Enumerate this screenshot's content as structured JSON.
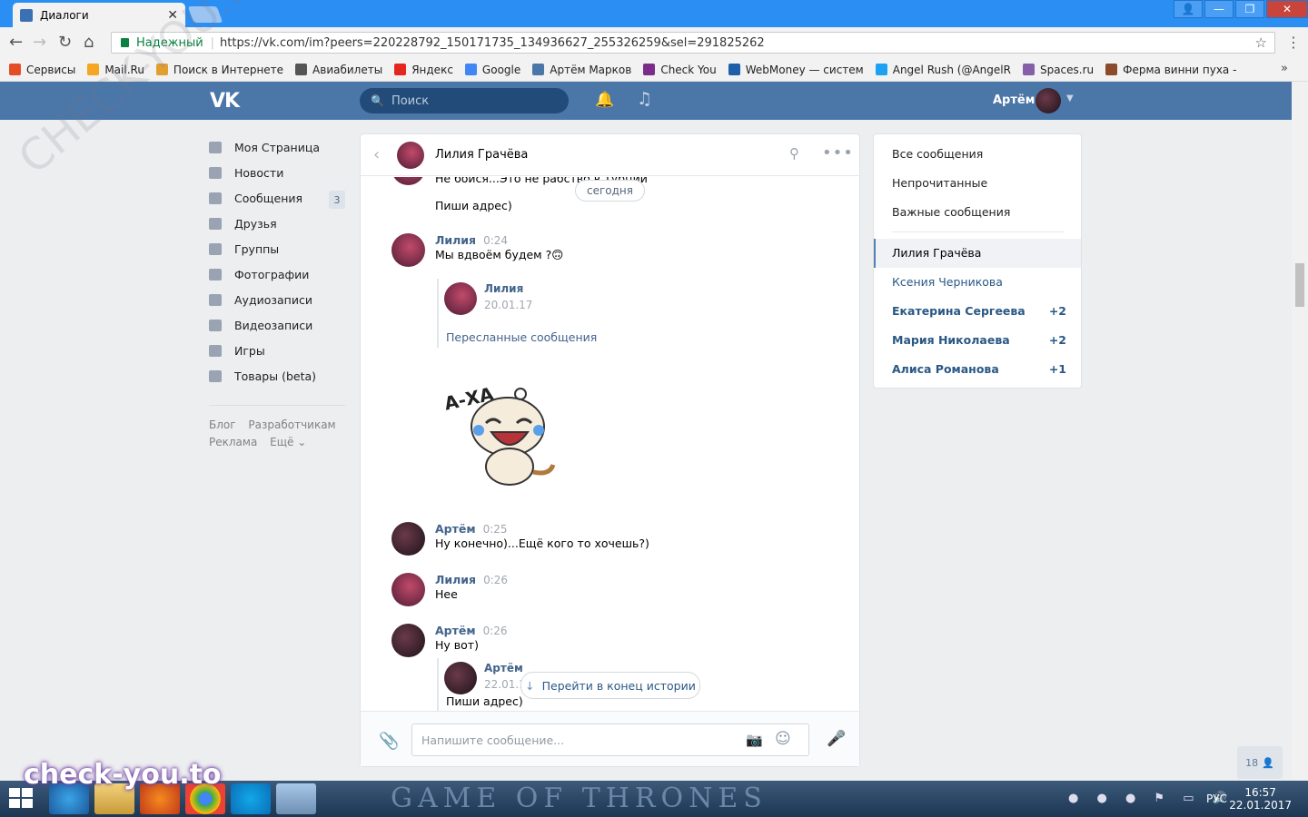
{
  "browser": {
    "tab_title": "Диалоги",
    "secure_label": "Надежный",
    "url": "https://vk.com/im?peers=220228792_150171735_134936627_255326259&sel=291825262"
  },
  "bookmarks": [
    {
      "label": "Сервисы",
      "icon": "apps-grid-icon",
      "color": "#e44d26"
    },
    {
      "label": "Mail.Ru",
      "icon": "mailru-icon",
      "color": "#f5a623"
    },
    {
      "label": "Поиск в Интернете",
      "icon": "search-key-icon",
      "color": "#e0a030"
    },
    {
      "label": "Авиабилеты",
      "icon": "plane-icon",
      "color": "#555555"
    },
    {
      "label": "Яндекс",
      "icon": "yandex-icon",
      "color": "#e52620"
    },
    {
      "label": "Google",
      "icon": "google-icon",
      "color": "#4285f4"
    },
    {
      "label": "Артём Марков",
      "icon": "vk-icon",
      "color": "#4a76a8"
    },
    {
      "label": "Check You",
      "icon": "checkyou-icon",
      "color": "#7b2d8b"
    },
    {
      "label": "WebMoney — систем",
      "icon": "webmoney-icon",
      "color": "#1f5fa8"
    },
    {
      "label": "Angel Rush (@AngelR",
      "icon": "twitter-icon",
      "color": "#1da1f2"
    },
    {
      "label": "Spaces.ru",
      "icon": "spaces-icon",
      "color": "#8560a8"
    },
    {
      "label": "Ферма винни пуха -",
      "icon": "farm-icon",
      "color": "#8b4a2b"
    }
  ],
  "header": {
    "search_placeholder": "Поиск",
    "user_name": "Артём"
  },
  "leftnav": {
    "items": [
      {
        "label": "Моя Страница",
        "icon": "home-icon"
      },
      {
        "label": "Новости",
        "icon": "news-icon"
      },
      {
        "label": "Сообщения",
        "icon": "messages-icon",
        "badge": "3"
      },
      {
        "label": "Друзья",
        "icon": "friends-icon"
      },
      {
        "label": "Группы",
        "icon": "groups-icon"
      },
      {
        "label": "Фотографии",
        "icon": "camera-icon"
      },
      {
        "label": "Аудиозаписи",
        "icon": "music-icon"
      },
      {
        "label": "Видеозаписи",
        "icon": "video-icon"
      },
      {
        "label": "Игры",
        "icon": "gamepad-icon"
      },
      {
        "label": "Товары (beta)",
        "icon": "bag-icon"
      }
    ],
    "footer": [
      "Блог",
      "Разработчикам",
      "Реклама",
      "Ещё"
    ]
  },
  "chat": {
    "peer_name": "Лилия Грачёва",
    "date_pill": "сегодня",
    "partial_top_text": "Не бойся...Это не рабство в Турции",
    "first_text": "Пиши адрес)",
    "messages": [
      {
        "author": "Лилия",
        "time": "0:24",
        "text": "Мы вдвоём будем ?🙃"
      },
      {
        "author": "Артём",
        "time": "0:25",
        "text": "Ну конечно)...Ещё кого то хочешь?)"
      },
      {
        "author": "Лилия",
        "time": "0:26",
        "text": "Нее"
      },
      {
        "author": "Артём",
        "time": "0:26",
        "text": "Ну вот)"
      }
    ],
    "fwd1": {
      "author": "Лилия",
      "date": "20.01.17",
      "link": "Пересланные сообщения"
    },
    "sticker_text": "А-ХА",
    "fwd2": {
      "author": "Артём",
      "date": "22.01.17",
      "text": "Пиши адрес)"
    },
    "jump_label": "Перейти в конец истории",
    "input_placeholder": "Напишите сообщение..."
  },
  "rightpanel": {
    "filters": [
      "Все сообщения",
      "Непрочитанные",
      "Важные сообщения"
    ],
    "dialogs": [
      {
        "name": "Лилия Грачёва",
        "count": ""
      },
      {
        "name": "Ксения Черникова",
        "count": ""
      },
      {
        "name": "Екатерина Сергеева",
        "count": "+2"
      },
      {
        "name": "Мария Николаева",
        "count": "+2"
      },
      {
        "name": "Алиса Романова",
        "count": "+1"
      }
    ]
  },
  "online_count": "18",
  "taskbar": {
    "lang": "РУС",
    "time": "16:57",
    "date": "22.01.2017"
  },
  "watermark": "check-you.to",
  "watermark_diag": "CHECK-YOU.ME",
  "bg_text": "GAME OF THRONES"
}
